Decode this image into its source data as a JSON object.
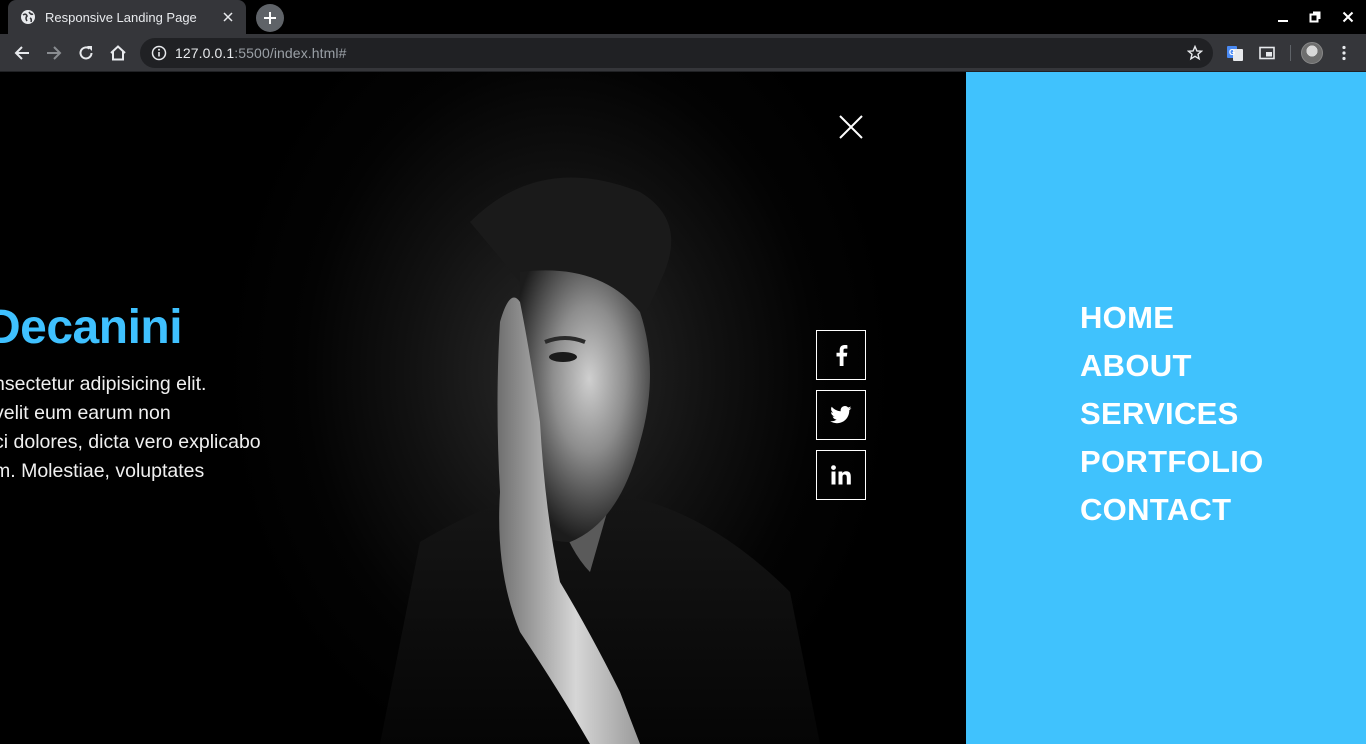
{
  "browser": {
    "tab_title": "Responsive Landing Page",
    "url_host": "127.0.0.1",
    "url_rest": ":5500/index.html#"
  },
  "hero": {
    "heading": "Decanini",
    "paragraph_lines": [
      "nsectetur adipisicing elit.",
      "velit eum earum non",
      "ci dolores, dicta vero explicabo",
      "m. Molestiae, voluptates"
    ]
  },
  "socials": [
    "f",
    "twitter-bird",
    "in"
  ],
  "nav": {
    "items": [
      "HOME",
      "ABOUT",
      "SERVICES",
      "PORTFOLIO",
      "CONTACT"
    ]
  },
  "colors": {
    "accent": "#40c2fd",
    "heading_blue": "#3fc1ff",
    "background": "#000000"
  }
}
